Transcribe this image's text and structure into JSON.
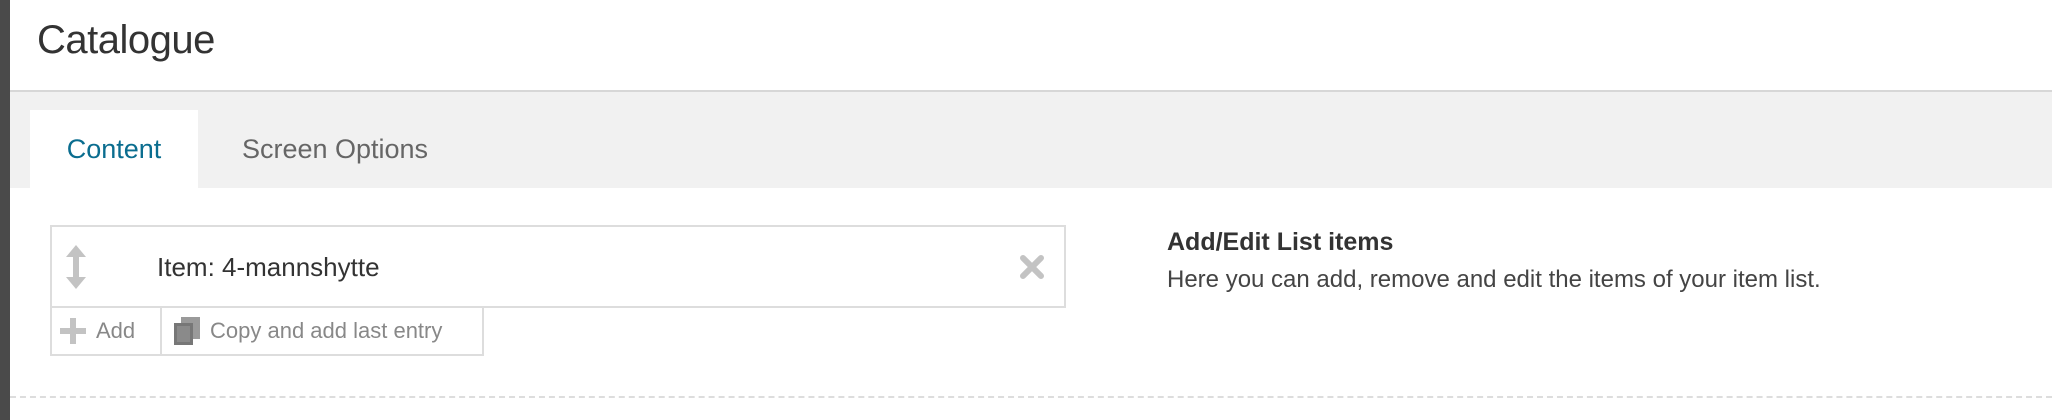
{
  "header": {
    "title": "Catalogue"
  },
  "tabs": [
    {
      "label": "Content",
      "active": true
    },
    {
      "label": "Screen Options",
      "active": false
    }
  ],
  "list": {
    "items": [
      {
        "label": "Item: 4-mannshytte"
      }
    ],
    "add_label": "Add",
    "copy_label": "Copy and add last entry"
  },
  "help": {
    "title": "Add/Edit List items",
    "text": "Here you can add, remove and edit the items of your item list."
  },
  "icons": {
    "drag": "drag-handle-icon",
    "remove": "close-icon",
    "add": "plus-icon",
    "copy": "copy-icon"
  },
  "colors": {
    "active_tab_text": "#0a6d8f",
    "tab_bar_bg": "#f1f1f1",
    "icon_gray": "#c3c3c3"
  }
}
